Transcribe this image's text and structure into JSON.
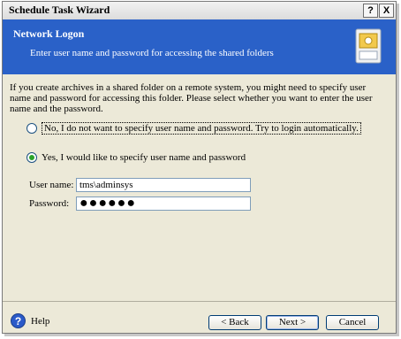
{
  "window": {
    "title": "Schedule Task Wizard",
    "help_btn": "?",
    "close_btn": "X"
  },
  "header": {
    "title": "Network Logon",
    "subtitle": "Enter user name and password for accessing the shared folders"
  },
  "description": "If you create archives in a shared folder on a remote system, you might need to specify user name and password for accessing this folder. Please select whether you want to enter the user name and the password.",
  "options": [
    {
      "label": "No, I do not want to specify user name and password. Try to login automatically.",
      "selected": false
    },
    {
      "label": "Yes, I would like to specify user name and password",
      "selected": true
    }
  ],
  "form": {
    "username_label": "User name:",
    "username_value": "tms\\adminsys",
    "password_label": "Password:",
    "password_value": "●●●●●●"
  },
  "footer": {
    "help_label": "Help",
    "back_label": "< Back",
    "next_label": "Next >",
    "cancel_label": "Cancel"
  },
  "colors": {
    "header_bg": "#2a61c8",
    "dialog_bg": "#ece9d8",
    "radio_dot": "#2aa32a"
  }
}
